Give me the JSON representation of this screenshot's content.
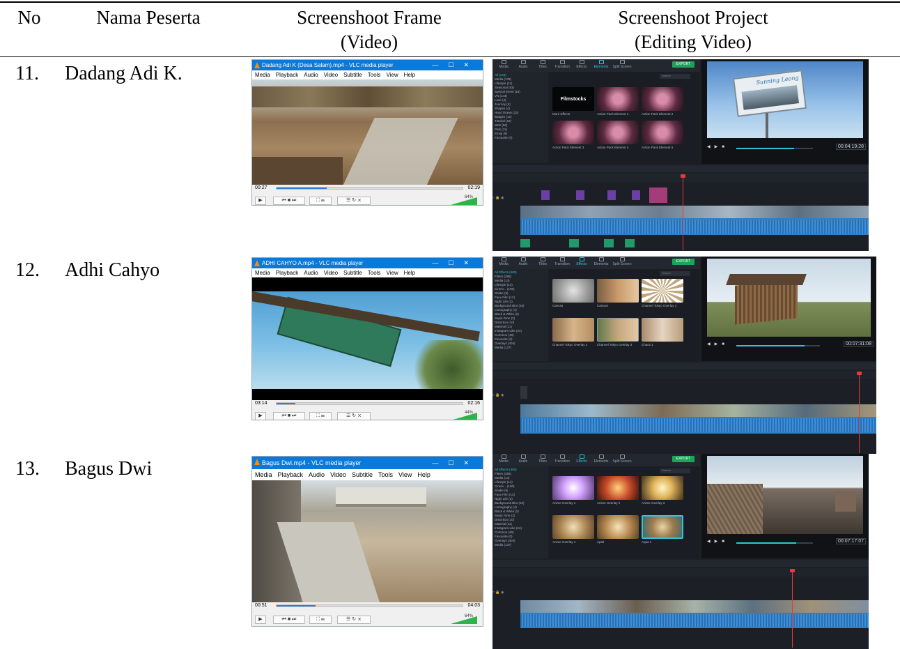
{
  "header": {
    "col_no": "No",
    "col_nama": "Nama Peserta",
    "col_frame_line1": "Screenshoot Frame",
    "col_frame_line2": "(Video)",
    "col_project_line1": "Screenshoot Project",
    "col_project_line2": "(Editing Video)"
  },
  "rows": [
    {
      "no": "11.",
      "nama": "Dadang Adi K.",
      "vlc": {
        "title": "Dadang Adi K (Desa Salam).mp4 - VLC media player",
        "time_left": "00:27",
        "time_right": "02:19",
        "progress": 0.27,
        "volume": "64%"
      },
      "editor": {
        "timecode": "00:04:19:28",
        "active_tab": "Elements",
        "categories": [
          "All (133)",
          "Media (133)",
          "Lifestyle (11)",
          "Seasonal (93)",
          "Special Event (16)",
          "VN (144)",
          "Love (4)",
          "Journey (4)",
          "Shapes (4)",
          "Hand Drawn (23)",
          "Badges (12)",
          "Tutorial (64)",
          "Web (56)",
          "Pets (11)",
          "Emoji (9)",
          "Favourite (0)"
        ],
        "thumbs": [
          "Filmstocks",
          "Action Pack Element 1",
          "Action Pack Element 2",
          "Action Pack Element 3",
          "Action Pack Element 4",
          "Action Pack Element 5"
        ],
        "thumb_first_label": "More Effects",
        "preview_sign_text": "Sunning Leong",
        "progress": 0.75
      }
    },
    {
      "no": "12.",
      "nama": "Adhi Cahyo",
      "vlc": {
        "title": "ADHI CAHYO A.mp4 - VLC media player",
        "time_left": "03:14",
        "time_right": "02:16",
        "progress": 0.1,
        "volume": "44%"
      },
      "editor": {
        "timecode": "00:07:31:08",
        "active_tab": "Effects",
        "categories": [
          "All Effects (400)",
          "Filters (286)",
          "Media (14)",
          "Lifestyle (14)",
          "Cinem... (100)",
          "Shake (8)",
          "Faux Film (12)",
          "Night Life (3)",
          "Background Blur (16)",
          "Lomography (4)",
          "Black & White (2)",
          "Sepia Tone (2)",
          "Distortion (10)",
          "Material (11)",
          "Instagram-Like (24)",
          "Common (49)",
          "Favourite (0)",
          "Overlays (404)",
          "Media (137)"
        ],
        "thumbs": [
          "Canvas",
          "Cartoon",
          "Channel Tokyo Overlay 1",
          "Channel Tokyo Overlay 2",
          "Channel Tokyo Overlay 3",
          "Chaos 1"
        ],
        "progress": 0.82
      }
    },
    {
      "no": "13.",
      "nama": "Bagus Dwi",
      "vlc": {
        "title": "Bagus Dwi.mp4 - VLC media player",
        "time_left": "00:51",
        "time_right": "04:03",
        "progress": 0.21,
        "volume": "64%"
      },
      "editor": {
        "timecode": "00:07:17:07",
        "active_tab": "Effects",
        "categories": [
          "All Effects (400)",
          "Filters (286)",
          "Media (14)",
          "Lifestyle (14)",
          "Cinem... (100)",
          "Shake (8)",
          "Faux Film (12)",
          "Night Life (3)",
          "Background Blur (16)",
          "Lomography (4)",
          "Black & White (2)",
          "Sepia Tone (2)",
          "Distortion (10)",
          "Material (11)",
          "Instagram-Like (24)",
          "Common (49)",
          "Favourite (0)",
          "Overlays (404)",
          "Media (137)"
        ],
        "thumbs": [
          "Anime Overlay 1",
          "Anime Overlay 2",
          "Anime Overlay 3",
          "Anime Overlay 4",
          "Aptal",
          "Aqua 1"
        ],
        "progress": 0.78
      }
    }
  ],
  "vlc_menu": [
    "Media",
    "Playback",
    "Audio",
    "Video",
    "Subtitle",
    "Tools",
    "View",
    "Help"
  ],
  "editor_tabs": [
    "Media",
    "Audio",
    "Titles",
    "Transition",
    "Effects",
    "Elements",
    "Split Screen"
  ],
  "editor_export_label": "EXPORT",
  "editor_search_placeholder": "Search",
  "colors": {
    "vlc_titlebar": "#0b79d9",
    "vlc_progress": "#2f7fd6",
    "vlc_volume": "#2fb24c",
    "editor_bg": "#1c1f26",
    "editor_accent": "#33c3d9",
    "editor_export": "#1aa65a",
    "timeline_video": "#3a6fa8",
    "timeline_audio": "#2f7fc4",
    "timeline_effect": "#6b3fa6",
    "playhead": "#e63a3a"
  }
}
